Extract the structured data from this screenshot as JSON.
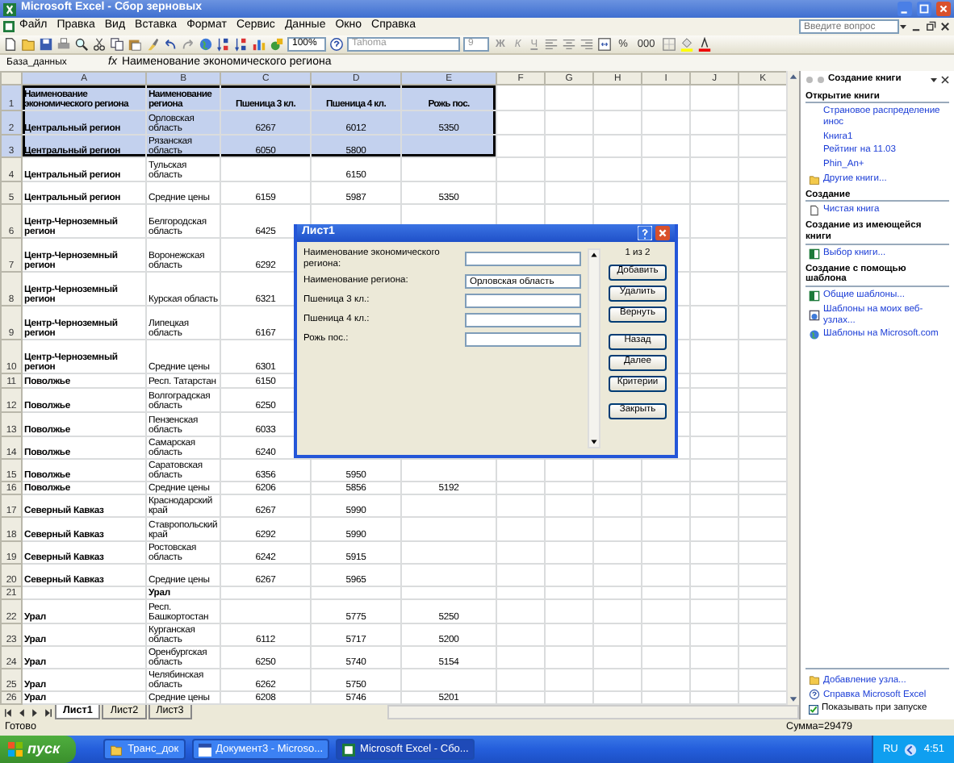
{
  "window": {
    "title": "Microsoft Excel - Сбор зерновых"
  },
  "menu": [
    "Файл",
    "Правка",
    "Вид",
    "Вставка",
    "Формат",
    "Сервис",
    "Данные",
    "Окно",
    "Справка"
  ],
  "help_search": {
    "placeholder": "Введите вопрос"
  },
  "toolbar": {
    "zoom": "100%",
    "font": "Tahoma",
    "font_size": "9",
    "format_buttons": [
      "Ж",
      "К",
      "Ч"
    ],
    "number_buttons": [
      "%",
      "000"
    ]
  },
  "formula_bar": {
    "name_box": "База_данных",
    "fx": "fx",
    "formula": "Наименование экономического региона"
  },
  "sheet": {
    "columns": [
      {
        "label": "A",
        "selected": true
      },
      {
        "label": "B",
        "selected": true
      },
      {
        "label": "C",
        "selected": true
      },
      {
        "label": "D",
        "selected": true
      },
      {
        "label": "E",
        "selected": true
      },
      {
        "label": "F",
        "selected": false
      },
      {
        "label": "G",
        "selected": false
      },
      {
        "label": "H",
        "selected": false
      },
      {
        "label": "I",
        "selected": false
      },
      {
        "label": "J",
        "selected": false
      },
      {
        "label": "K",
        "selected": false
      }
    ],
    "rows": [
      {
        "label": "1",
        "selected": true,
        "kind": "header",
        "cells": [
          "Наименование экономического региона",
          "Наименование региона",
          "Пшеница 3 кл.",
          "Пшеница 4 кл.",
          "Рожь пос."
        ]
      },
      {
        "label": "2",
        "selected": true,
        "kind": "data",
        "cells": [
          "Центральный регион",
          "Орловская область",
          "6267",
          "6012",
          "5350"
        ]
      },
      {
        "label": "3",
        "selected": true,
        "kind": "data",
        "cells": [
          "Центральный регион",
          "Рязанская область",
          "6050",
          "5800",
          null
        ]
      },
      {
        "label": "4",
        "selected": false,
        "kind": "data",
        "cells": [
          "Центральный регион",
          "Тульская область",
          null,
          "6150",
          null
        ]
      },
      {
        "label": "5",
        "selected": false,
        "kind": "data",
        "cells": [
          "Центральный регион",
          "Средние цены",
          "6159",
          "5987",
          "5350"
        ]
      },
      {
        "label": "6",
        "selected": false,
        "kind": "data",
        "cells": [
          "Центр-Черноземный регион",
          "Белгородская область",
          "6425",
          null,
          null
        ]
      },
      {
        "label": "7",
        "selected": false,
        "kind": "data",
        "cells": [
          "Центр-Черноземный регион",
          "Воронежская область",
          "6292",
          null,
          null
        ]
      },
      {
        "label": "8",
        "selected": false,
        "kind": "data",
        "cells": [
          "Центр-Черноземный регион",
          "Курская область",
          "6321",
          null,
          null
        ]
      },
      {
        "label": "9",
        "selected": false,
        "kind": "data",
        "cells": [
          "Центр-Черноземный регион",
          "Липецкая область",
          "6167",
          null,
          null
        ]
      },
      {
        "label": "10",
        "selected": false,
        "kind": "data",
        "cells": [
          "Центр-Черноземный регион",
          "Средние цены",
          "6301",
          null,
          null
        ]
      },
      {
        "label": "11",
        "selected": false,
        "kind": "data",
        "cells": [
          "Поволжье",
          "Респ. Татарстан",
          "6150",
          null,
          null
        ]
      },
      {
        "label": "12",
        "selected": false,
        "kind": "data",
        "cells": [
          "Поволжье",
          "Волгоградская область",
          "6250",
          null,
          null
        ]
      },
      {
        "label": "13",
        "selected": false,
        "kind": "data",
        "cells": [
          "Поволжье",
          "Пензенская область",
          "6033",
          null,
          null
        ]
      },
      {
        "label": "14",
        "selected": false,
        "kind": "data",
        "cells": [
          "Поволжье",
          "Самарская область",
          "6240",
          null,
          null
        ]
      },
      {
        "label": "15",
        "selected": false,
        "kind": "data",
        "cells": [
          "Поволжье",
          "Саратовская область",
          "6356",
          "5950",
          null
        ]
      },
      {
        "label": "16",
        "selected": false,
        "kind": "data",
        "cells": [
          "Поволжье",
          "Средние цены",
          "6206",
          "5856",
          "5192"
        ]
      },
      {
        "label": "17",
        "selected": false,
        "kind": "data",
        "cells": [
          "Северный Кавказ",
          "Краснодарский край",
          "6267",
          "5990",
          null
        ]
      },
      {
        "label": "18",
        "selected": false,
        "kind": "data",
        "cells": [
          "Северный Кавказ",
          "Ставропольский край",
          "6292",
          "5990",
          null
        ]
      },
      {
        "label": "19",
        "selected": false,
        "kind": "data",
        "cells": [
          "Северный Кавказ",
          "Ростовская область",
          "6242",
          "5915",
          null
        ]
      },
      {
        "label": "20",
        "selected": false,
        "kind": "data",
        "cells": [
          "Северный Кавказ",
          "Средние цены",
          "6267",
          "5965",
          null
        ]
      },
      {
        "label": "21",
        "selected": false,
        "kind": "group",
        "cells": [
          null,
          "Урал",
          null,
          null,
          null
        ]
      },
      {
        "label": "22",
        "selected": false,
        "kind": "data",
        "cells": [
          "Урал",
          "Респ. Башкортостан",
          null,
          "5775",
          "5250"
        ]
      },
      {
        "label": "23",
        "selected": false,
        "kind": "data",
        "cells": [
          "Урал",
          "Курганская область",
          "6112",
          "5717",
          "5200"
        ]
      },
      {
        "label": "24",
        "selected": false,
        "kind": "data",
        "cells": [
          "Урал",
          "Оренбургская область",
          "6250",
          "5740",
          "5154"
        ]
      },
      {
        "label": "25",
        "selected": false,
        "kind": "data",
        "cells": [
          "Урал",
          "Челябинская область",
          "6262",
          "5750",
          null
        ]
      },
      {
        "label": "26",
        "selected": false,
        "kind": "data",
        "cells": [
          "Урал",
          "Средние цены",
          "6208",
          "5746",
          "5201"
        ]
      }
    ]
  },
  "sheet_tabs": [
    {
      "label": "Лист1",
      "selected": true
    },
    {
      "label": "Лист2",
      "selected": false
    },
    {
      "label": "Лист3",
      "selected": false
    }
  ],
  "dialog": {
    "title": "Лист1",
    "fields": [
      {
        "label": "Наименование экономического региона:"
      },
      {
        "label": "Наименование региона:",
        "value": "Орловская область"
      },
      {
        "label": "Пшеница 3 кл.:"
      },
      {
        "label": "Пшеница 4 кл.:"
      },
      {
        "label": "Рожь пос.:"
      }
    ],
    "record": "1 из 2",
    "buttons": [
      {
        "label": "Добавить",
        "kind": "edit"
      },
      {
        "label": "Удалить",
        "kind": "edit"
      },
      {
        "label": "Вернуть",
        "kind": "edit"
      },
      {
        "label": "Назад",
        "kind": "nav"
      },
      {
        "label": "Далее",
        "kind": "nav"
      },
      {
        "label": "Критерии",
        "kind": "nav"
      },
      {
        "label": "Закрыть",
        "kind": "close"
      }
    ]
  },
  "task_pane": {
    "title": "Создание книги",
    "sections": [
      {
        "title": "Открытие книги",
        "items": [
          {
            "text": "Страновое распределение инос",
            "kind": "recent"
          },
          {
            "text": "Книга1",
            "kind": "recent"
          },
          {
            "text": "Рейтинг на 11.03",
            "kind": "recent"
          },
          {
            "text": "Phin_An+",
            "kind": "recent"
          },
          {
            "text": "Другие книги...",
            "kind": "folder"
          }
        ]
      },
      {
        "title": "Создание",
        "items": [
          {
            "text": "Чистая книга",
            "kind": "blank"
          }
        ]
      },
      {
        "title": "Создание из имеющейся книги",
        "items": [
          {
            "text": "Выбор книги...",
            "kind": "workbook"
          }
        ]
      },
      {
        "title": "Создание с помощью шаблона",
        "items": [
          {
            "text": "Общие шаблоны...",
            "kind": "workbook"
          },
          {
            "text": "Шаблоны на моих веб-узлах...",
            "kind": "web"
          },
          {
            "text": "Шаблоны на Microsoft.com",
            "kind": "globe"
          }
        ]
      }
    ],
    "footer": [
      {
        "text": "Добавление узла...",
        "kind": "folder"
      },
      {
        "text": "Справка Microsoft Excel",
        "kind": "help"
      }
    ],
    "show_at_startup": {
      "label": "Показывать при запуске",
      "checked": true
    }
  },
  "status_bar": {
    "text": "Готово",
    "sum": "Сумма=29479"
  },
  "taskbar": {
    "start": "пуск",
    "tasks": [
      {
        "label": "Транс_док",
        "kind": "folder",
        "selected": false
      },
      {
        "label": "Документ3 - Microso...",
        "kind": "word",
        "selected": false
      },
      {
        "label": "Microsoft Excel - Сбо...",
        "kind": "excel",
        "selected": true
      }
    ],
    "language": "RU",
    "clock": "4:51"
  }
}
